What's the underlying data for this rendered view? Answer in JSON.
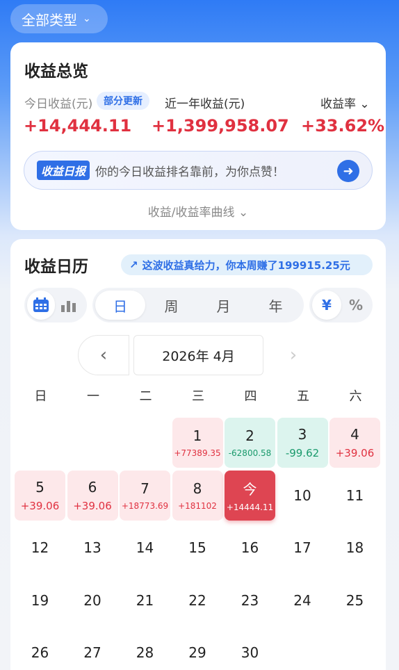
{
  "type_filter": {
    "label": "全部类型"
  },
  "overview": {
    "title": "收益总览",
    "today_label": "今日收益(元)",
    "partial_badge": "部分更新",
    "year_label": "近一年收益(元)",
    "rate_label": "收益率",
    "today_value": "+14,444.11",
    "year_value": "+1,399,958.07",
    "rate_value": "+33.62%",
    "banner_tag": "收益日报",
    "banner_text": "你的今日收益排名靠前，为你点赞！",
    "curve_link": "收益/收益率曲线"
  },
  "calendar": {
    "title": "收益日历",
    "promo": "这波收益真给力，你本周赚了199915.25元",
    "periods": [
      "日",
      "周",
      "月",
      "年"
    ],
    "active_period": "日",
    "units": [
      "¥",
      "%"
    ],
    "month_label": "2026年 4月",
    "weekdays": [
      "日",
      "一",
      "二",
      "三",
      "四",
      "五",
      "六"
    ],
    "days": [
      {
        "n": "1",
        "amt": "+77389.35",
        "type": "pos"
      },
      {
        "n": "2",
        "amt": "-62800.58",
        "type": "neg"
      },
      {
        "n": "3",
        "amt": "-99.62",
        "type": "neg"
      },
      {
        "n": "4",
        "amt": "+39.06",
        "type": "pos"
      },
      {
        "n": "5",
        "amt": "+39.06",
        "type": "pos"
      },
      {
        "n": "6",
        "amt": "+39.06",
        "type": "pos"
      },
      {
        "n": "7",
        "amt": "+18773.69",
        "type": "pos"
      },
      {
        "n": "8",
        "amt": "+181102",
        "type": "pos"
      },
      {
        "n": "今",
        "amt": "+14444.11",
        "type": "today"
      },
      {
        "n": "10",
        "amt": "",
        "type": ""
      },
      {
        "n": "11",
        "amt": "",
        "type": ""
      },
      {
        "n": "12",
        "amt": "",
        "type": ""
      },
      {
        "n": "13",
        "amt": "",
        "type": ""
      },
      {
        "n": "14",
        "amt": "",
        "type": ""
      },
      {
        "n": "15",
        "amt": "",
        "type": ""
      },
      {
        "n": "16",
        "amt": "",
        "type": ""
      },
      {
        "n": "17",
        "amt": "",
        "type": ""
      },
      {
        "n": "18",
        "amt": "",
        "type": ""
      },
      {
        "n": "19",
        "amt": "",
        "type": ""
      },
      {
        "n": "20",
        "amt": "",
        "type": ""
      },
      {
        "n": "21",
        "amt": "",
        "type": ""
      },
      {
        "n": "22",
        "amt": "",
        "type": ""
      },
      {
        "n": "23",
        "amt": "",
        "type": ""
      },
      {
        "n": "24",
        "amt": "",
        "type": ""
      },
      {
        "n": "25",
        "amt": "",
        "type": ""
      },
      {
        "n": "26",
        "amt": "",
        "type": ""
      },
      {
        "n": "27",
        "amt": "",
        "type": ""
      },
      {
        "n": "28",
        "amt": "",
        "type": ""
      },
      {
        "n": "29",
        "amt": "",
        "type": ""
      },
      {
        "n": "30",
        "amt": "",
        "type": ""
      }
    ]
  },
  "colors": {
    "accent": "#2f6fe6",
    "gain": "#e03140",
    "loss": "#1a9a6c"
  }
}
